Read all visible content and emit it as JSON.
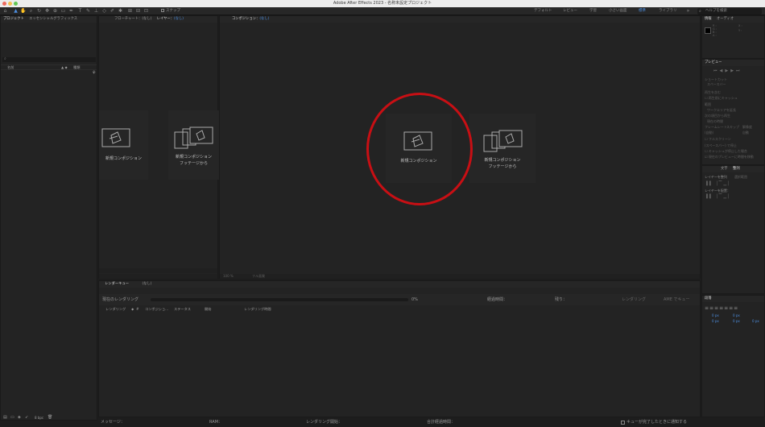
{
  "app": {
    "title": "Adobe After Effects 2023 - 名称未設定プロジェクト"
  },
  "toolbar": {
    "snap_label": "スナップ",
    "workspaces": [
      "デフォルト",
      "レビュー",
      "学習",
      "小さい画面",
      "標準",
      "ライブラリ"
    ],
    "active_workspace": "標準",
    "search_placeholder": "ヘルプを検索"
  },
  "project_panel": {
    "tabs": [
      "プロジェクト",
      "エッセンシャルグラフィックス"
    ],
    "col_name": "名前",
    "col_type": "種類",
    "bpc": "8 bpc"
  },
  "layer_panel": {
    "flowchart_tab": "フローチャート：(なし)",
    "layer_tab": "レイヤー",
    "layer_tab_value": "(なし)",
    "card_new_comp": "新規コンポジション",
    "card_from_footage_1": "新規コンポジション",
    "card_from_footage_2": "フッテージから"
  },
  "comp_panel": {
    "tab_label": "コンポジション",
    "tab_value": "(なし)",
    "card_new_comp": "新規コンポジション",
    "card_from_footage_1": "新規コンポジション",
    "card_from_footage_2": "フッテージから",
    "zoom": "100 %",
    "resolution": "フル画質"
  },
  "info_panel": {
    "tabs": [
      "情報",
      "オーディオ"
    ],
    "rgb": [
      "R :",
      "G :",
      "B :",
      "A :"
    ],
    "xy": [
      "X :",
      "Y :"
    ]
  },
  "preview_panel": {
    "title": "プレビュー",
    "shortcut_label": "ショートカット",
    "shortcut_value": "スペースバー",
    "include_label": "再生を含む",
    "cache_before": "再生前にキャッシュ",
    "range_label": "範囲",
    "range_value": "ワークエリアを延長",
    "play_from_label": "次の項目から再生",
    "play_from_value": "現在の時間",
    "frame_rate": "フレームレート",
    "skip": "スキップ",
    "resolution": "解像度",
    "auto": "(自動)",
    "auto2": "自動",
    "fullscreen": "フルスクリーン",
    "stop_label": "(スペースバー) で停止",
    "option1": "キャッシュが停止した場合",
    "option2": "現在のプレビューに時間を移動"
  },
  "character_panel": {
    "tabs": [
      "文字",
      "整列"
    ],
    "align_label": "レイヤーを整列",
    "align_value": "選択範囲",
    "distribute_label": "レイヤーを配置："
  },
  "tracker_panel": {
    "title": "段落",
    "indent": [
      "0 px",
      "0 px",
      "0 px",
      "0 px",
      "0 px"
    ]
  },
  "render_queue": {
    "tab_label": "レンダーキュー",
    "tab_value": "(なし)",
    "current_render": "現在のレンダリング",
    "percent": "0%",
    "queue_in_ame": "AME でキュー",
    "render_button": "レンダリング",
    "elapsed_label": "経過時間：",
    "remaining_label": "残り：",
    "columns": [
      "レンダリング",
      "#",
      "コンポジショ...",
      "ステータス",
      "開始",
      "レンダリング時間"
    ]
  },
  "status_bar": {
    "message": "メッセージ：",
    "ram": "RAM：",
    "render_start": "レンダリング開始：",
    "total_elapsed": "合計経過時間：",
    "notify": "キューが完了したときに通知する"
  },
  "colors": {
    "accent": "#4d8fe0",
    "highlight_circle": "#c80f14",
    "bg": "#1d1d1d",
    "panel": "#232323"
  }
}
